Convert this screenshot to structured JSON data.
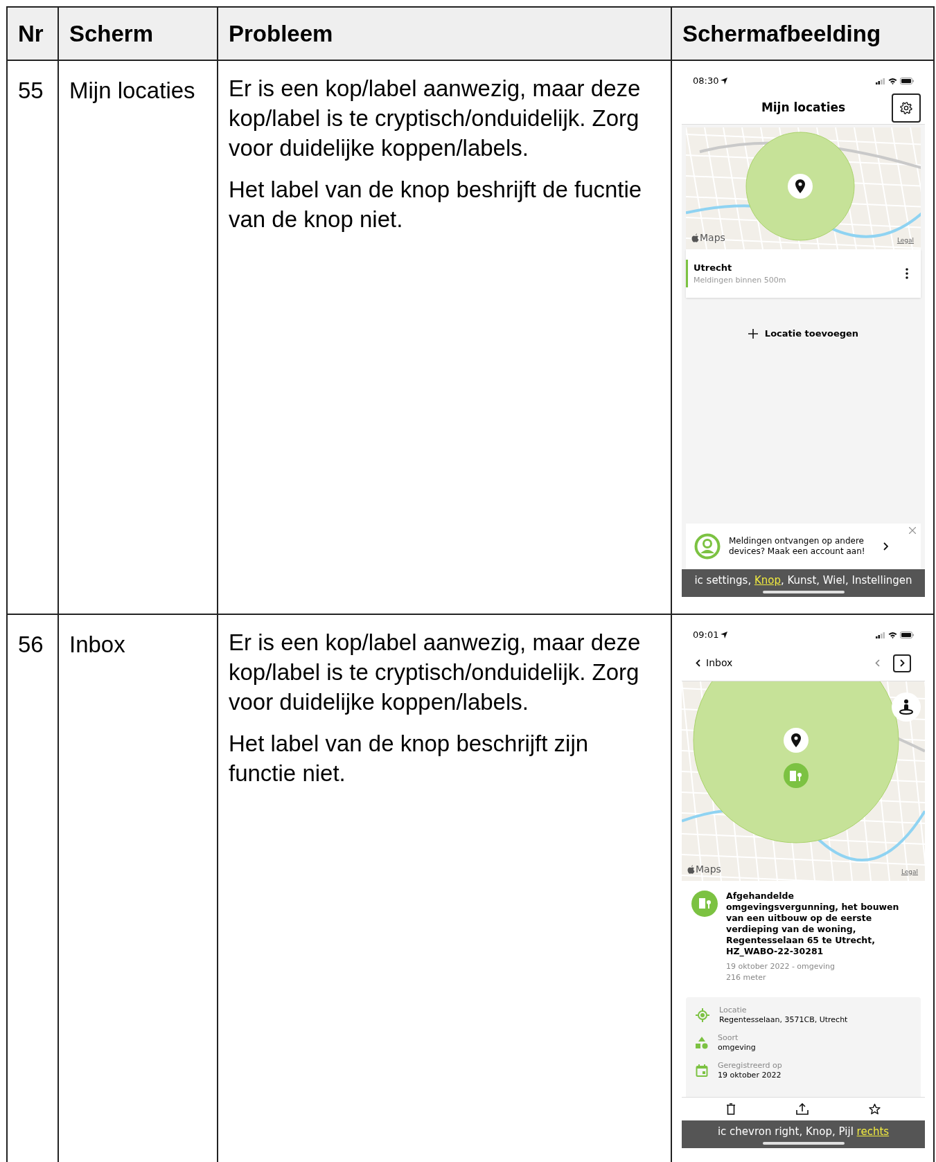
{
  "table": {
    "columns": [
      "Nr",
      "Scherm",
      "Probleem",
      "Schermafbeelding"
    ],
    "rows": [
      {
        "nr": "55",
        "screen": "Mijn locaties",
        "problem": [
          "Er is een kop/label aanwezig, maar deze kop/label is te cryptisch/onduidelijk. Zorg voor duidelijke koppen/labels.",
          "Het label van de knop beshrijft de fucntie van de knop niet."
        ],
        "screenshot": {
          "kind": "locations",
          "time": "08:30",
          "title": "Mijn locaties",
          "settings_focused": true,
          "map": {
            "attribution": "Maps",
            "legal": "Legal"
          },
          "locations": [
            {
              "name": "Utrecht",
              "subtitle": "Meldingen binnen 500m",
              "color": "#7cc242"
            }
          ],
          "add_button": "Locatie toevoegen",
          "banner": {
            "text": "Meldingen ontvangen op andere devices? Maak een account aan!"
          },
          "caption": [
            {
              "text": "ic settings, ",
              "highlighted": false
            },
            {
              "text": "Knop",
              "highlighted": true
            },
            {
              "text": ", Kunst, Wiel, Instellingen",
              "highlighted": false
            }
          ]
        }
      },
      {
        "nr": "56",
        "screen": "Inbox",
        "problem": [
          "Er is een kop/label aanwezig, maar deze kop/label is te cryptisch/onduidelijk. Zorg voor duidelijke koppen/labels.",
          "Het label van de knop beschrijft zijn functie niet."
        ],
        "screenshot": {
          "kind": "inbox",
          "time": "09:01",
          "back": "Inbox",
          "prev_focused": false,
          "next_focused": true,
          "map": {
            "attribution": "Maps",
            "legal": "Legal"
          },
          "item": {
            "title": "Afgehandelde omgevingsvergunning, het bouwen van een uitbouw op de eerste verdieping van de woning, Regentesselaan 65 te Utrecht, HZ_WABO-22-30281",
            "meta": [
              "19 oktober 2022 - omgeving",
              "216 meter"
            ]
          },
          "details": [
            {
              "kind": "location",
              "label": "Locatie",
              "value": "Regentesselaan, 3571CB, Utrecht"
            },
            {
              "kind": "type",
              "label": "Soort",
              "value": "omgeving"
            },
            {
              "kind": "date",
              "label": "Geregistreerd op",
              "value": "19 oktober 2022"
            }
          ],
          "caption": [
            {
              "text": "ic chevron right, Knop, Pijl ",
              "highlighted": false
            },
            {
              "text": "rechts",
              "highlighted": true
            }
          ]
        }
      }
    ]
  }
}
